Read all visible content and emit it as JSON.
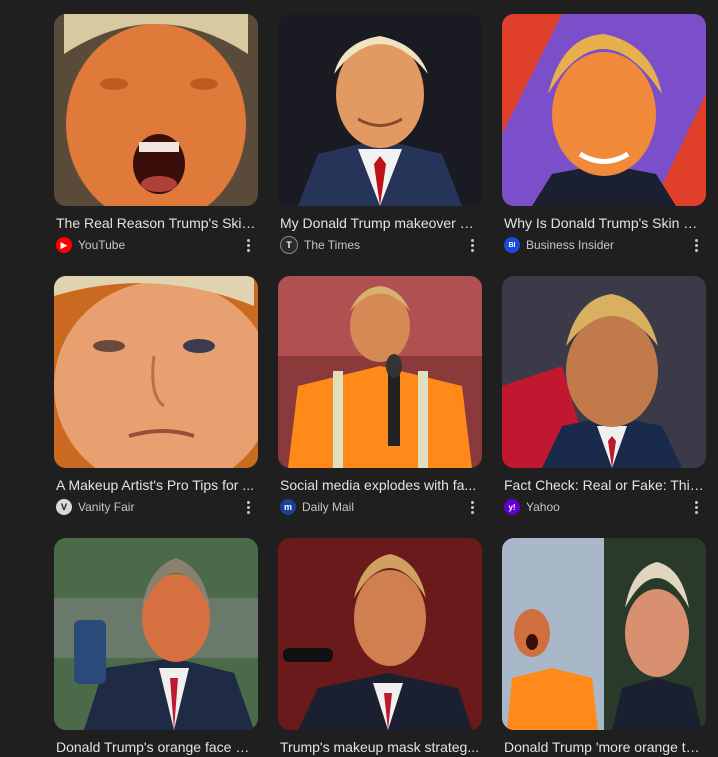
{
  "results": [
    {
      "title": "The Real Reason Trump's Skin ...",
      "source": "YouTube",
      "icon": "youtube-icon",
      "icon_color": "#ff0000",
      "icon_glyph": "▶"
    },
    {
      "title": "My Donald Trump makeover —...",
      "source": "The Times",
      "icon": "the-times-icon",
      "icon_color": "#2b2b2b",
      "icon_glyph": "T"
    },
    {
      "title": "Why Is Donald Trump's Skin Or...",
      "source": "Business Insider",
      "icon": "business-insider-icon",
      "icon_color": "#1b49d8",
      "icon_glyph": "BI"
    },
    {
      "title": "A Makeup Artist's Pro Tips for ...",
      "source": "Vanity Fair",
      "icon": "vanity-fair-icon",
      "icon_color": "#d9d9d9",
      "icon_glyph": "V"
    },
    {
      "title": "Social media explodes with fa...",
      "source": "Daily Mail",
      "icon": "daily-mail-icon",
      "icon_color": "#1a3f9c",
      "icon_glyph": "m"
    },
    {
      "title": "Fact Check: Real or Fake: This ...",
      "source": "Yahoo",
      "icon": "yahoo-icon",
      "icon_color": "#6001d2",
      "icon_glyph": "y!"
    },
    {
      "title": "Donald Trump's orange face m...",
      "source": "",
      "icon": "",
      "icon_color": "",
      "icon_glyph": ""
    },
    {
      "title": "Trump's makeup mask strateg...",
      "source": "",
      "icon": "",
      "icon_color": "",
      "icon_glyph": ""
    },
    {
      "title": "Donald Trump 'more orange th...",
      "source": "",
      "icon": "",
      "icon_color": "",
      "icon_glyph": ""
    }
  ]
}
